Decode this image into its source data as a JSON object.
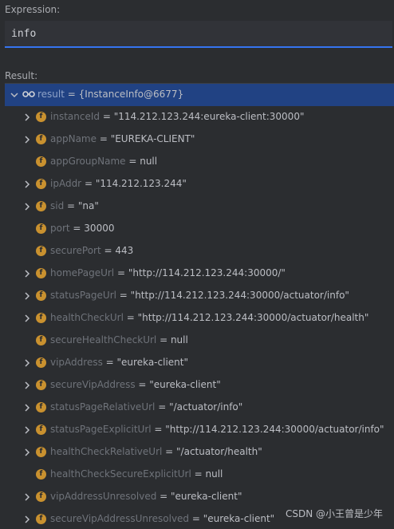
{
  "expression": {
    "label": "Expression:",
    "value": "info"
  },
  "result": {
    "label": "Result:",
    "root": {
      "name": "result",
      "eq": " = ",
      "value": "{InstanceInfo@6677}"
    },
    "fields": [
      {
        "name": "instanceId",
        "value": "\"114.212.123.244:eureka-client:30000\"",
        "expandable": true
      },
      {
        "name": "appName",
        "value": "\"EUREKA-CLIENT\"",
        "expandable": true
      },
      {
        "name": "appGroupName",
        "value": "null",
        "expandable": false
      },
      {
        "name": "ipAddr",
        "value": "\"114.212.123.244\"",
        "expandable": true
      },
      {
        "name": "sid",
        "value": "\"na\"",
        "expandable": true
      },
      {
        "name": "port",
        "value": "30000",
        "expandable": false
      },
      {
        "name": "securePort",
        "value": "443",
        "expandable": false
      },
      {
        "name": "homePageUrl",
        "value": "\"http://114.212.123.244:30000/\"",
        "expandable": true
      },
      {
        "name": "statusPageUrl",
        "value": "\"http://114.212.123.244:30000/actuator/info\"",
        "expandable": true
      },
      {
        "name": "healthCheckUrl",
        "value": "\"http://114.212.123.244:30000/actuator/health\"",
        "expandable": true
      },
      {
        "name": "secureHealthCheckUrl",
        "value": "null",
        "expandable": false
      },
      {
        "name": "vipAddress",
        "value": "\"eureka-client\"",
        "expandable": true
      },
      {
        "name": "secureVipAddress",
        "value": "\"eureka-client\"",
        "expandable": true
      },
      {
        "name": "statusPageRelativeUrl",
        "value": "\"/actuator/info\"",
        "expandable": true
      },
      {
        "name": "statusPageExplicitUrl",
        "value": "\"http://114.212.123.244:30000/actuator/info\"",
        "expandable": true
      },
      {
        "name": "healthCheckRelativeUrl",
        "value": "\"/actuator/health\"",
        "expandable": true
      },
      {
        "name": "healthCheckSecureExplicitUrl",
        "value": "null",
        "expandable": false
      },
      {
        "name": "vipAddressUnresolved",
        "value": "\"eureka-client\"",
        "expandable": true
      },
      {
        "name": "secureVipAddressUnresolved",
        "value": "\"eureka-client\"",
        "expandable": true
      }
    ]
  },
  "field_badge": "f",
  "watermark": "CSDN @小王曾是少年"
}
